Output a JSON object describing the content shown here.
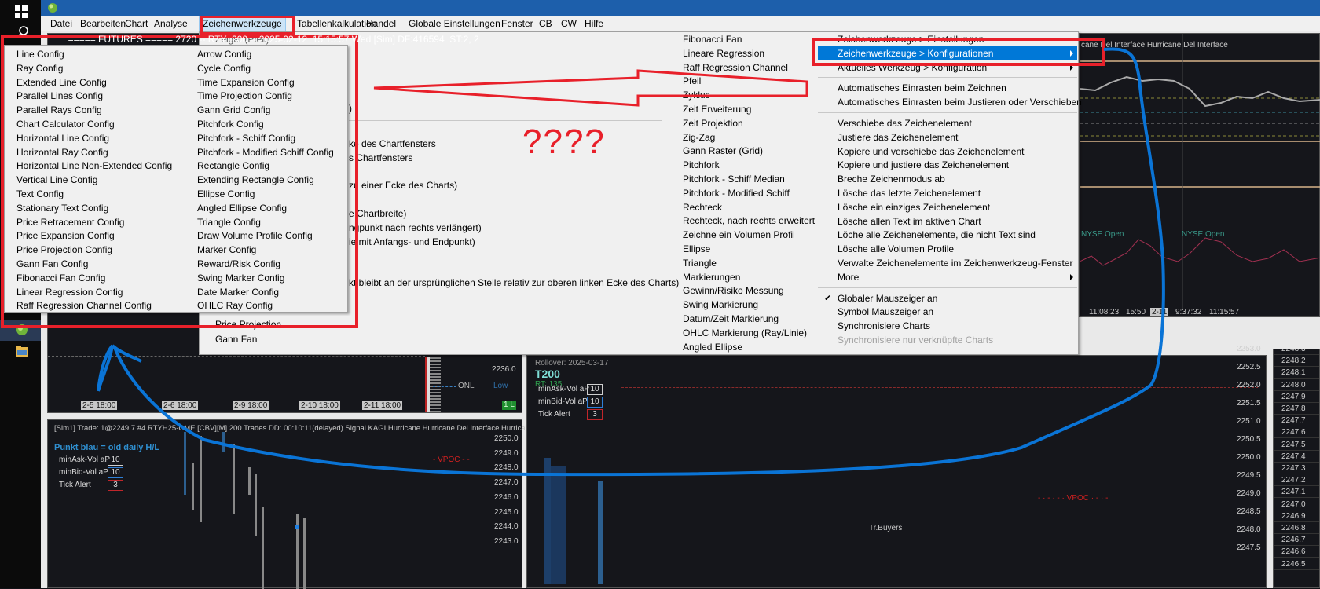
{
  "taskbar": {
    "icons": [
      "windows-icon",
      "search-icon",
      "globe-app-icon",
      "folder-icon"
    ]
  },
  "titlebar": {
    "title": "===== FUTURES ===== 2720 -- RTY  200 -- 2025-02-12  15:15:57 Wed [Sim] DF:416594  ST:2, 2"
  },
  "menubar": {
    "items": [
      "Datei",
      "Bearbeiten",
      "Chart",
      "Analyse",
      "Zeichenwerkzeuge",
      "Tabellenkalkulation",
      "Handel",
      "Globale Einstellungen",
      "Fenster",
      "CB",
      "CW",
      "Hilfe"
    ],
    "active": "Zeichenwerkzeuge"
  },
  "main_menu": {
    "col1_visible": [
      "Zeiger (Pfeil)",
      "Price Projection",
      "Gann Fan"
    ],
    "col1_fragments": [
      ")",
      "ke des Chartfensters",
      "s Chartfensters",
      "zu einer Ecke des Charts)",
      "e Chartbreite)",
      "ngpunkt nach rechts verlängert)",
      "ie mit Anfangs- und Endpunkt)",
      "kt bleibt an der ursprünglichen Stelle relativ zur oberen linken Ecke des Charts)"
    ],
    "col2": [
      "Fibonacci Fan",
      "Lineare Regression",
      "Raff Regression Channel",
      "Pfeil",
      "Zyklus",
      "Zeit Erweiterung",
      "Zeit Projektion",
      "Zig-Zag",
      "Gann Raster (Grid)",
      "Pitchfork",
      "Pitchfork - Schiff Median",
      "Pitchfork - Modified Schiff",
      "Rechteck",
      "Rechteck, nach rechts erweitert",
      "Zeichne ein Volumen Profil",
      "Ellipse",
      "Triangle",
      "Markierungen",
      "Gewinn/Risiko Messung",
      "Swing Markierung",
      "Datum/Zeit Markierung",
      "OHLC Markierung (Ray/Linie)",
      "Angled Ellipse"
    ],
    "col3": [
      {
        "label": "Zeichenwerkzeuge > Einstellungen"
      },
      {
        "label": "Zeichenwerkzeuge > Konfigurationen",
        "submenu": true,
        "highlighted": true
      },
      {
        "label": "Aktuelles Werkzeug > Konfiguration",
        "submenu": true
      },
      {
        "sep": true
      },
      {
        "label": "Automatisches Einrasten beim Zeichnen"
      },
      {
        "label": "Automatisches Einrasten beim Justieren oder Verschieben"
      },
      {
        "sep": true
      },
      {
        "label": "Verschiebe das Zeichenelement"
      },
      {
        "label": "Justiere das Zeichenelement"
      },
      {
        "label": "Kopiere und verschiebe das Zeichenelement"
      },
      {
        "label": "Kopiere und justiere das Zeichenelement"
      },
      {
        "label": "Breche Zeichenmodus ab"
      },
      {
        "label": "Lösche das letzte Zeichenelement"
      },
      {
        "label": "Lösche ein einziges Zeichenelement"
      },
      {
        "label": "Lösche allen Text im aktiven Chart"
      },
      {
        "label": "Löche alle Zeichenelemente, die nicht Text sind"
      },
      {
        "label": "Lösche alle Volumen Profile"
      },
      {
        "label": "Verwalte Zeichenelemente im Zeichenwerkzeug-Fenster"
      },
      {
        "label": "More",
        "submenu": true
      },
      {
        "sep": true
      },
      {
        "label": "Globaler Mauszeiger an",
        "checked": true
      },
      {
        "label": "Symbol Mauszeiger an"
      },
      {
        "label": "Synchronisiere Charts"
      },
      {
        "label": "Synchronisiere nur verknüpfte Charts",
        "disabled": true
      }
    ]
  },
  "config_submenu": {
    "col1": [
      "Line Config",
      "Ray Config",
      "Extended Line Config",
      "Parallel Lines Config",
      "Parallel Rays Config",
      "Chart Calculator Config",
      "Horizontal Line Config",
      "Horizontal Ray Config",
      "Horizontal Line Non-Extended Config",
      "Vertical Line Config",
      "Text Config",
      "Stationary Text Config",
      "Price Retracement Config",
      "Price Expansion Config",
      "Price Projection Config",
      "Gann Fan Config",
      "Fibonacci Fan Config",
      "Linear Regression Config",
      "Raff Regression Channel Config"
    ],
    "col2": [
      "Arrow Config",
      "Cycle Config",
      "Time Expansion Config",
      "Time Projection Config",
      "Gann Grid Config",
      "Pitchfork Config",
      "Pitchfork - Schiff Config",
      "Pitchfork - Modified Schiff Config",
      "Rectangle Config",
      "Extending Rectangle Config",
      "Ellipse Config",
      "Angled Ellipse Config",
      "Triangle Config",
      "Draw Volume Profile Config",
      "Marker Config",
      "Reward/Risk Config",
      "Swing Marker Config",
      "Date Marker Config",
      "OHLC Ray Config"
    ]
  },
  "annotation": {
    "question_text": "????",
    "color": "#e8202a",
    "stroke_color": "#0a74d6"
  },
  "charts": {
    "top_left": {
      "price": "2236.0",
      "onl": "ONL",
      "low": "Low",
      "badge": "1 L",
      "time_labels": [
        "2-5  18:00",
        "2-6  18:00",
        "2-9  18:00",
        "2-10  18:00",
        "2-11  18:00"
      ]
    },
    "top_right": {
      "header": "cane Del  Interface  Hurricane Del Interface",
      "nyse": [
        "NYSE Open",
        "NYSE Open"
      ],
      "time_labels": [
        "11:08:23",
        "15:50",
        "2-11",
        "9:37:32",
        "11:15:57"
      ]
    },
    "bottom_left": {
      "header": "[Sim1]  Trade: 1@2249.7  #4 RTYH25-CME [CBV][M] 200 Trades DD: 00:10:11(delayed) Signal KAGI  Hurricane  Hurricane Del Interface  Hurricane",
      "legend": "Punkt blau = old daily H/L",
      "fields": [
        {
          "label": "minAsk-Vol aP",
          "value": "10",
          "color": "#cfcfcf"
        },
        {
          "label": "minBid-Vol aP",
          "value": "10",
          "color": "#2f7fd6"
        },
        {
          "label": "Tick Alert",
          "value": "3",
          "color": "#c0262b"
        }
      ],
      "vpoc": "VPOC",
      "prices": [
        "2250.0",
        "2249.0",
        "2248.0",
        "2247.0",
        "2246.0",
        "2245.0",
        "2244.0",
        "2243.0"
      ]
    },
    "bottom_mid": {
      "rollover": "Rollover: 2025-03-17",
      "symbol": "T200",
      "rt": "RT: 135",
      "fields": [
        {
          "label": "minAsk-Vol aP",
          "value": "10",
          "color": "#cfcfcf"
        },
        {
          "label": "minBid-Vol aP",
          "value": "10",
          "color": "#2f7fd6"
        },
        {
          "label": "Tick Alert",
          "value": "3",
          "color": "#c0262b"
        }
      ],
      "vpoc": "VPOC",
      "buyers": "Tr.Buyers",
      "prices": [
        "2253.0",
        "2252.5",
        "2252.0",
        "2251.5",
        "2251.0",
        "2250.5",
        "2250.0",
        "2249.5",
        "2249.0",
        "2248.5",
        "2248.0",
        "2247.5"
      ]
    },
    "ladder": {
      "prices": [
        "2248.3",
        "2248.2",
        "2248.1",
        "2248.0",
        "2247.9",
        "2247.8",
        "2247.7",
        "2247.6",
        "2247.5",
        "2247.4",
        "2247.3",
        "2247.2",
        "2247.1",
        "2247.0",
        "2246.9",
        "2246.8",
        "2246.7",
        "2246.6",
        "2246.5"
      ]
    }
  }
}
